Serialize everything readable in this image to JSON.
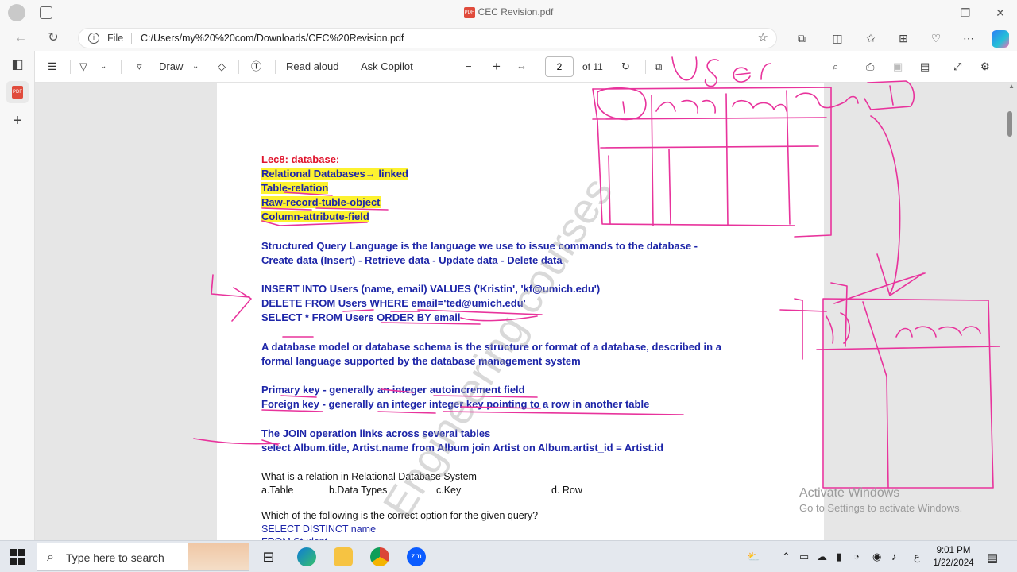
{
  "window": {
    "title": "CEC Revision.pdf"
  },
  "address_bar": {
    "file_label": "File",
    "url": "C:/Users/my%20%20com/Downloads/CEC%20Revision.pdf"
  },
  "pdf_toolbar": {
    "draw_label": "Draw",
    "read_aloud_label": "Read aloud",
    "ask_copilot_label": "Ask Copilot",
    "page_number": "2",
    "page_total": "of 11"
  },
  "document": {
    "heading": "Lec8: database:",
    "highlights": [
      "Relational Databases→ linked",
      "Table-relation",
      "Raw-record-tuble-object",
      "Column-attribute-field"
    ],
    "sql_desc": [
      "Structured Query Language is the language we use to issue commands to the database -",
      "Create data (Insert) - Retrieve data - Update data - Delete data"
    ],
    "sql_examples": [
      "INSERT INTO Users (name, email) VALUES ('Kristin', 'kf@umich.edu')",
      "DELETE FROM Users WHERE email='ted@umich.edu'",
      "SELECT * FROM Users ORDER BY email"
    ],
    "model_desc": [
      "A database model or database schema is the structure or format of a database, described in a",
      "formal language supported by the database management system"
    ],
    "keys": [
      "Primary key - generally an integer autoincrement field",
      "Foreign key - generally an integer  integer key pointing to a row in another table"
    ],
    "join": [
      "The JOIN operation links across several tables",
      "select Album.title, Artist.name from Album join Artist on Album.artist_id = Artist.id"
    ],
    "q1": {
      "question": "What is a relation in Relational Database System",
      "options": [
        "a.Table",
        "b.Data Types",
        "c.Key",
        "d. Row"
      ]
    },
    "q2": {
      "question": "Which of the following is the correct option for the given query?",
      "code": [
        "SELECT DISTINCT name",
        "FROM Student"
      ]
    }
  },
  "watermark": "Engineering courses",
  "activate_windows": {
    "title": "Activate Windows",
    "subtitle": "Go to Settings to activate Windows."
  },
  "taskbar": {
    "search_placeholder": "Type here to search",
    "time": "9:01 PM",
    "date": "1/22/2024",
    "lang": "ع"
  },
  "colors": {
    "ink": "#e8339c",
    "highlight": "#fdf22f",
    "sql_blue": "#1d25a8",
    "heading_red": "#e0142c"
  }
}
